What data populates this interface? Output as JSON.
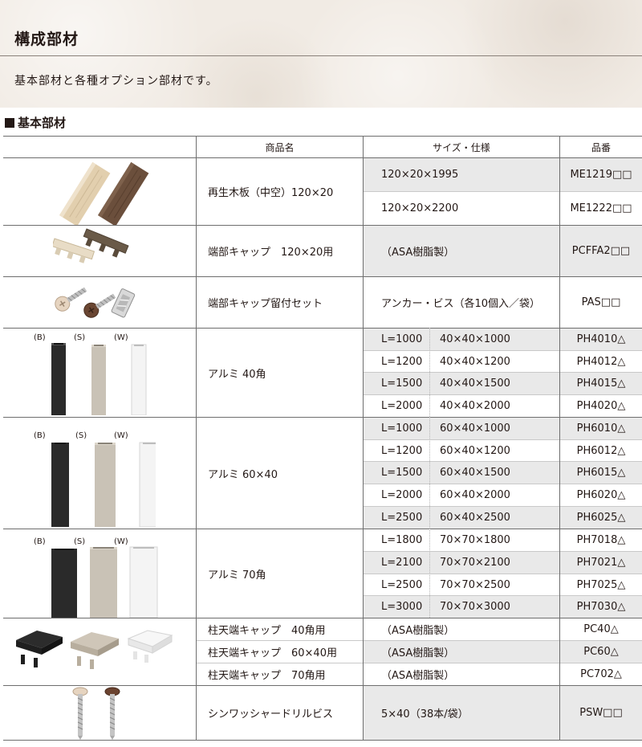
{
  "header": {
    "title": "構成部材",
    "description": "基本部材と各種オプション部材です。"
  },
  "section": {
    "title": "基本部材"
  },
  "table": {
    "headers": {
      "name": "商品名",
      "spec": "サイズ・仕様",
      "code": "品番"
    },
    "boards": {
      "name": "再生木板（中空）120×20",
      "rows": [
        {
          "spec": "120×20×1995",
          "code": "ME1219□□"
        },
        {
          "spec": "120×20×2200",
          "code": "ME1222□□"
        }
      ]
    },
    "endcap": {
      "name": "端部キャップ　120×20用",
      "spec": "（ASA樹脂製）",
      "code": "PCFFA2□□"
    },
    "capset": {
      "name": "端部キャップ留付セット",
      "spec": "アンカー・ビス（各10個入／袋）",
      "code": "PAS□□"
    },
    "color_labels": [
      "(B)",
      "(S)",
      "(W)"
    ],
    "alu40": {
      "name": "アルミ 40角",
      "rows": [
        {
          "length": "L=1000",
          "size": "40×40×1000",
          "code": "PH4010△"
        },
        {
          "length": "L=1200",
          "size": "40×40×1200",
          "code": "PH4012△"
        },
        {
          "length": "L=1500",
          "size": "40×40×1500",
          "code": "PH4015△"
        },
        {
          "length": "L=2000",
          "size": "40×40×2000",
          "code": "PH4020△"
        }
      ]
    },
    "alu6040": {
      "name": "アルミ 60×40",
      "rows": [
        {
          "length": "L=1000",
          "size": "60×40×1000",
          "code": "PH6010△"
        },
        {
          "length": "L=1200",
          "size": "60×40×1200",
          "code": "PH6012△"
        },
        {
          "length": "L=1500",
          "size": "60×40×1500",
          "code": "PH6015△"
        },
        {
          "length": "L=2000",
          "size": "60×40×2000",
          "code": "PH6020△"
        },
        {
          "length": "L=2500",
          "size": "60×40×2500",
          "code": "PH6025△"
        }
      ]
    },
    "alu70": {
      "name": "アルミ 70角",
      "rows": [
        {
          "length": "L=1800",
          "size": "70×70×1800",
          "code": "PH7018△"
        },
        {
          "length": "L=2100",
          "size": "70×70×2100",
          "code": "PH7021△"
        },
        {
          "length": "L=2500",
          "size": "70×70×2500",
          "code": "PH7025△"
        },
        {
          "length": "L=3000",
          "size": "70×70×3000",
          "code": "PH7030△"
        }
      ]
    },
    "topcaps": [
      {
        "name": "柱天端キャップ　40角用",
        "spec": "（ASA樹脂製）",
        "code": "PC40△"
      },
      {
        "name": "柱天端キャップ　60×40用",
        "spec": "（ASA樹脂製）",
        "code": "PC60△"
      },
      {
        "name": "柱天端キャップ　70角用",
        "spec": "（ASA樹脂製）",
        "code": "PC702△"
      }
    ],
    "screw": {
      "name": "シンワッシャードリルビス",
      "spec": "5×40（38本/袋）",
      "code": "PSW□□"
    }
  },
  "colors": {
    "black_post": "#2a2a2a",
    "silver_post": "#c9c2b6",
    "white_post": "#f4f4f4",
    "row_gray": "#e9e9e9"
  }
}
